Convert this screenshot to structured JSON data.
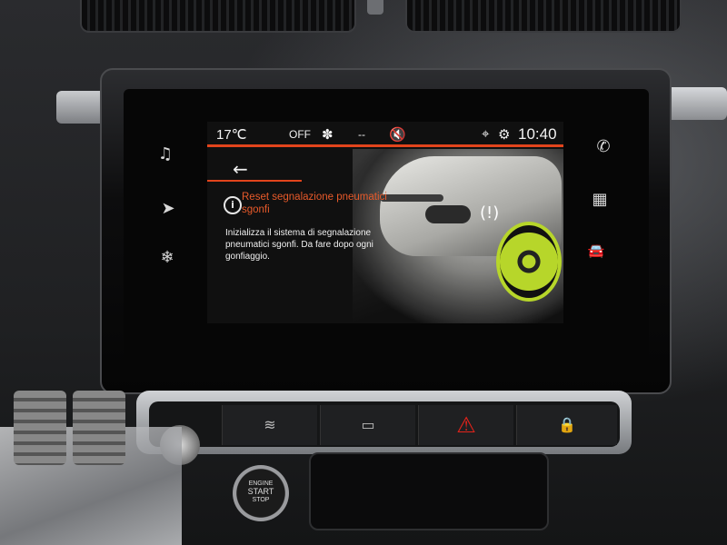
{
  "status_bar": {
    "temperature": "17℃",
    "ac_state": "OFF",
    "fan_icon": "fan-icon",
    "fan_level": "--",
    "mute_icon": "muted-speaker-icon",
    "location_icon": "location-pin-icon",
    "settings_icon": "gear-icon",
    "time": "10:40"
  },
  "left_menu": [
    {
      "icon": "music-note-icon",
      "glyph": "♫"
    },
    {
      "icon": "navigation-icon",
      "glyph": "➤"
    },
    {
      "icon": "climate-icon",
      "glyph": "❄"
    }
  ],
  "right_menu": [
    {
      "icon": "phone-icon",
      "glyph": "✆"
    },
    {
      "icon": "apps-grid-icon",
      "glyph": "▦"
    },
    {
      "icon": "car-icon",
      "glyph": "🚘"
    }
  ],
  "panel": {
    "back_glyph": "←",
    "title": "Reset segnalazione pneumatici sgonfi",
    "description": "Inizializza il sistema di segnalazione pneumatici sgonfi. Da fare dopo ogni gonfiaggio.",
    "info_glyph": "i"
  },
  "console_buttons": [
    {
      "icon": "windshield-defrost-icon",
      "glyph": "≋"
    },
    {
      "icon": "rear-defrost-icon",
      "glyph": "▭"
    },
    {
      "icon": "hazard-icon",
      "glyph": "⚠"
    },
    {
      "icon": "door-lock-icon",
      "glyph": "🔒"
    }
  ],
  "start_button": {
    "line1": "ENGINE",
    "line2": "START",
    "line3": "STOP"
  },
  "colors": {
    "accent": "#e2441c",
    "tire_highlight": "#b7d62a"
  }
}
